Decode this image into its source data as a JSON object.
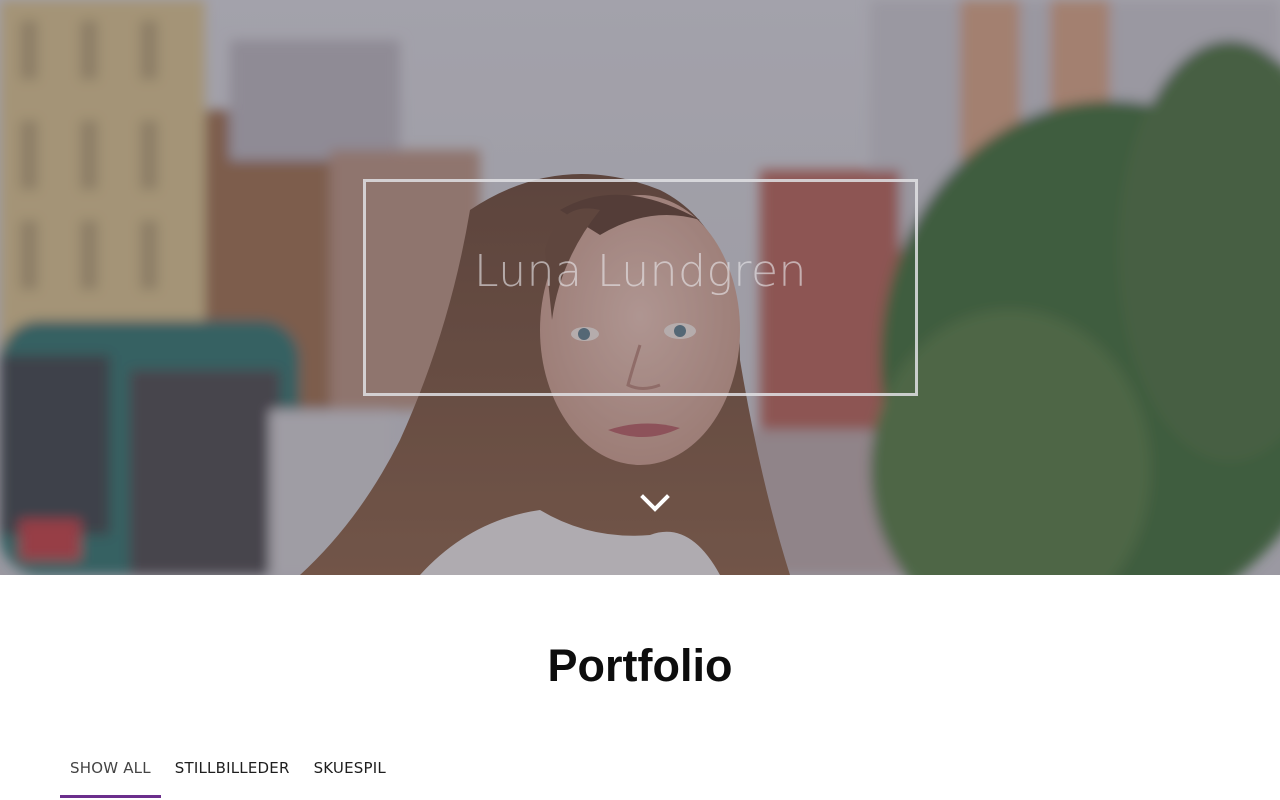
{
  "hero": {
    "title": "Luna Lundgren",
    "scroll_icon": "chevron-down-icon"
  },
  "portfolio": {
    "heading": "Portfolio",
    "filters": [
      {
        "label": "SHOW ALL",
        "active": true
      },
      {
        "label": "STILLBILLEDER",
        "active": false
      },
      {
        "label": "SKUESPIL",
        "active": false
      }
    ]
  },
  "colors": {
    "accent": "#6b2f8c",
    "heading_text": "#0d0d0d"
  }
}
